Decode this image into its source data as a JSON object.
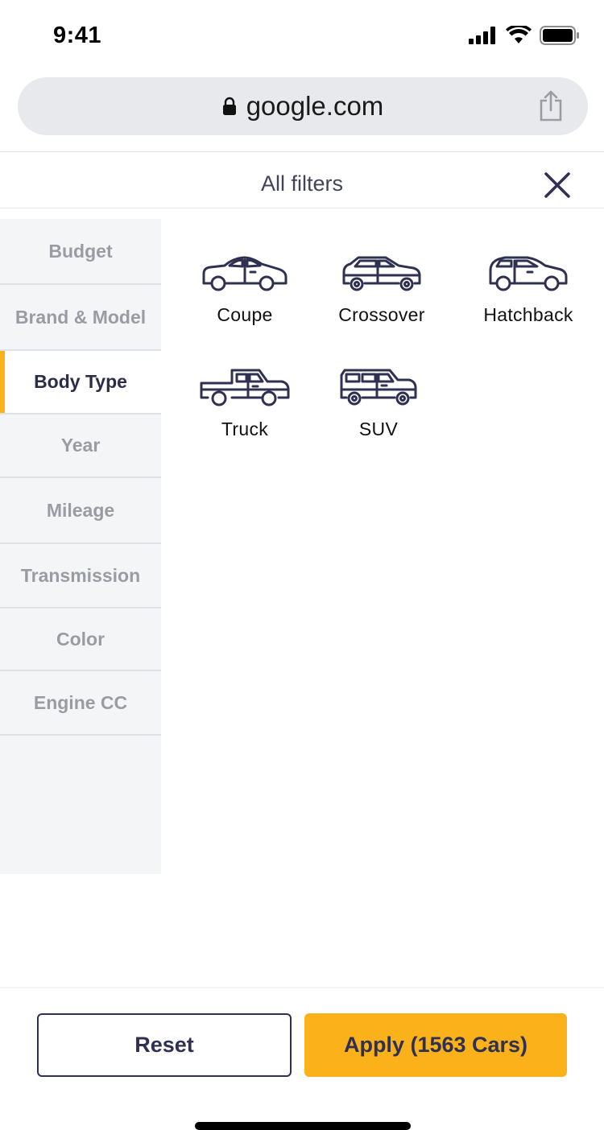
{
  "status_bar": {
    "time": "9:41",
    "signal_icon": "signal-icon",
    "wifi_icon": "wifi-icon",
    "battery_icon": "battery-icon"
  },
  "browser": {
    "url": "google.com",
    "lock_icon": "lock-icon",
    "share_icon": "share-icon"
  },
  "header": {
    "title": "All filters",
    "close_icon": "close-icon"
  },
  "sidebar": {
    "items": [
      {
        "label": "Budget",
        "active": false
      },
      {
        "label": "Brand & Model",
        "active": false
      },
      {
        "label": "Body Type",
        "active": true
      },
      {
        "label": "Year",
        "active": false
      },
      {
        "label": "Mileage",
        "active": false
      },
      {
        "label": "Transmission",
        "active": false
      },
      {
        "label": "Color",
        "active": false
      },
      {
        "label": "Engine CC",
        "active": false
      }
    ]
  },
  "body_types": [
    {
      "label": "Coupe",
      "icon": "coupe-icon"
    },
    {
      "label": "Crossover",
      "icon": "crossover-icon"
    },
    {
      "label": "Hatchback",
      "icon": "hatchback-icon"
    },
    {
      "label": "Truck",
      "icon": "truck-icon"
    },
    {
      "label": "SUV",
      "icon": "suv-icon"
    }
  ],
  "footer": {
    "reset_label": "Reset",
    "apply_label": "Apply (1563 Cars)"
  },
  "colors": {
    "accent": "#fbb21a",
    "navy": "#2f3152",
    "sidebar_bg": "#f4f5f7",
    "inactive_text": "#9a9ca3"
  }
}
